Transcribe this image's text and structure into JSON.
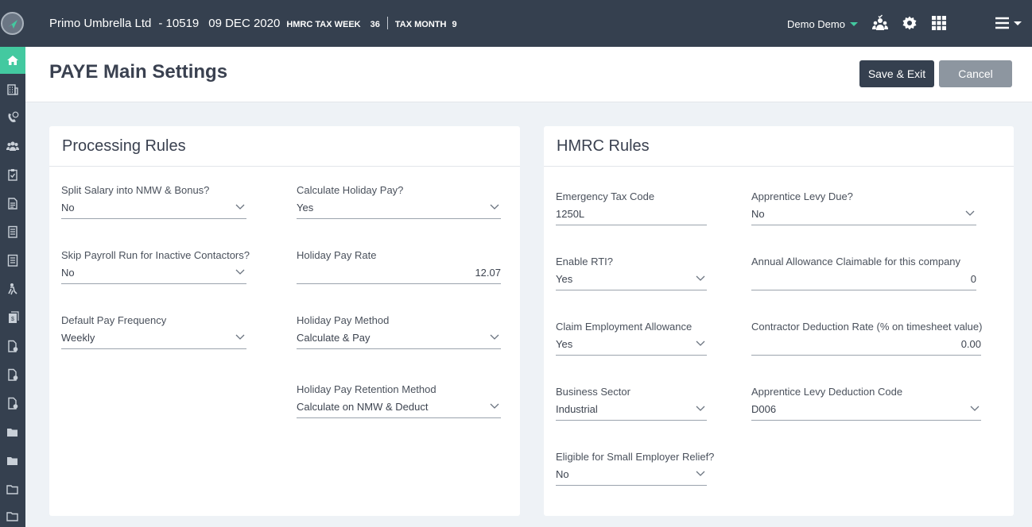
{
  "header": {
    "company": "Primo Umbrella Ltd",
    "company_id": "- 10519",
    "date": "09 DEC 2020",
    "tax_week_label": "HMRC TAX WEEK",
    "tax_week": "36",
    "tax_month_label": "TAX MONTH",
    "tax_month": "9",
    "user": "Demo Demo"
  },
  "title": "PAYE Main Settings",
  "buttons": {
    "save": "Save & Exit",
    "cancel": "Cancel"
  },
  "processing": {
    "title": "Processing Rules",
    "split_salary": {
      "label": "Split Salary into NMW & Bonus?",
      "value": "No"
    },
    "skip_payroll": {
      "label": "Skip Payroll Run for Inactive Contactors?",
      "value": "No"
    },
    "pay_frequency": {
      "label": "Default Pay Frequency",
      "value": "Weekly"
    },
    "calc_holiday": {
      "label": "Calculate Holiday Pay?",
      "value": "Yes"
    },
    "holiday_rate": {
      "label": "Holiday Pay Rate",
      "value": "12.07"
    },
    "holiday_method": {
      "label": "Holiday Pay Method",
      "value": "Calculate & Pay"
    },
    "holiday_retention": {
      "label": "Holiday Pay Retention Method",
      "value": "Calculate on NMW & Deduct"
    }
  },
  "hmrc": {
    "title": "HMRC Rules",
    "emergency_code": {
      "label": "Emergency Tax Code",
      "value": "1250L"
    },
    "enable_rti": {
      "label": "Enable RTI?",
      "value": "Yes"
    },
    "claim_employment": {
      "label": "Claim Employment Allowance",
      "value": "Yes"
    },
    "business_sector": {
      "label": "Business Sector",
      "value": "Industrial"
    },
    "small_employer": {
      "label": "Eligible for Small Employer Relief?",
      "value": "No"
    },
    "levy_due": {
      "label": "Apprentice Levy Due?",
      "value": "No"
    },
    "annual_allowance": {
      "label": "Annual Allowance Claimable for this company",
      "value": "0"
    },
    "contractor_rate": {
      "label": "Contractor Deduction Rate (% on timesheet value)",
      "value": "0.00"
    },
    "levy_code": {
      "label": "Apprentice Levy Deduction Code",
      "value": "D006"
    }
  },
  "colors": {
    "nav": "#35404f",
    "accent": "#43c9a0",
    "cancel": "#8d96a0"
  },
  "icons": [
    "home-icon",
    "building-icon",
    "phone-24-icon",
    "users-icon",
    "clipboard-icon",
    "document-icon",
    "report-icon",
    "ledger-icon",
    "worker-icon",
    "invoice-icon",
    "file-icon",
    "folder-icon",
    "people-check-icon",
    "gear-icon",
    "grid-icon",
    "menu-icon",
    "chevron-down-icon"
  ]
}
